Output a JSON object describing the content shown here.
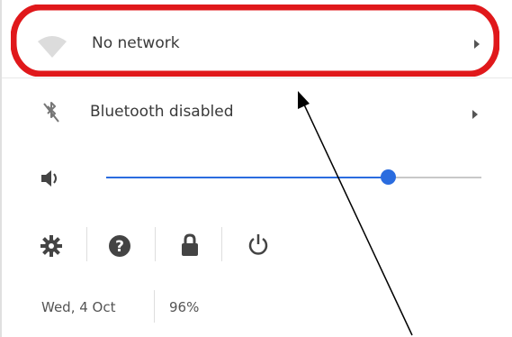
{
  "network": {
    "label": "No network"
  },
  "bluetooth": {
    "label": "Bluetooth disabled"
  },
  "volume": {
    "level_fraction": 0.75
  },
  "toolbar": {
    "icons": [
      "gear-icon",
      "help-icon",
      "lock-icon",
      "power-icon"
    ]
  },
  "status": {
    "date": "Wed, 4 Oct",
    "battery": "96%"
  },
  "colors": {
    "accent": "#2a6cdf",
    "highlight": "#e0181b",
    "icon": "#444444"
  }
}
